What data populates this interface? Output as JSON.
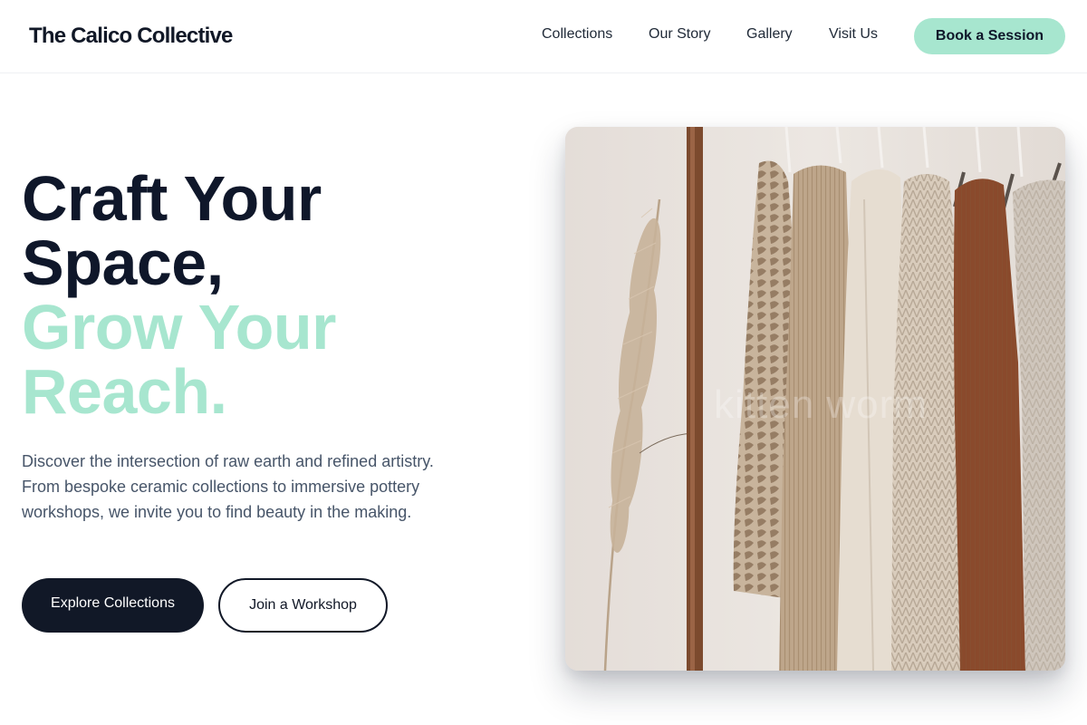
{
  "header": {
    "logo": "The Calico Collective",
    "nav": [
      "Collections",
      "Our Story",
      "Gallery",
      "Visit Us"
    ],
    "cta": "Book a Session"
  },
  "hero": {
    "headline_dark": [
      "Craft Your",
      "Space,"
    ],
    "headline_accent": [
      "Grow Your",
      "Reach."
    ],
    "description": "Discover the intersection of raw earth and refined artistry. From bespoke ceramic collections to immersive pottery workshops, we invite you to find beauty in the making.",
    "primary_button": "Explore Collections",
    "secondary_button": "Join a Workshop",
    "image_watermark": "kitten worm"
  },
  "colors": {
    "accent": "#a7e6cf",
    "dark": "#0f172a",
    "body_text": "#475569"
  }
}
